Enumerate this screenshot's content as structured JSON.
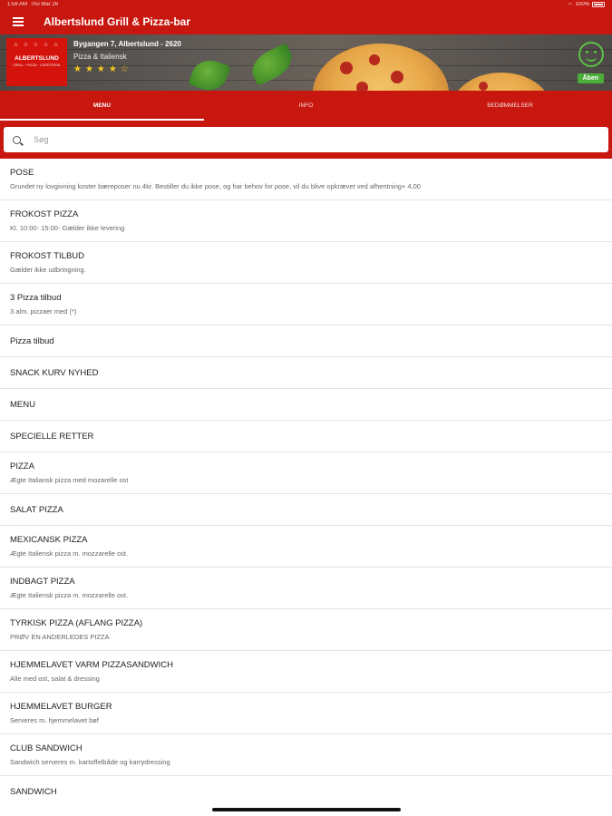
{
  "status_bar": {
    "time": "1:58 AM",
    "date": "Thu Mar 26",
    "wifi_icon": "wifi-icon",
    "battery": "100%"
  },
  "app_bar": {
    "menu_icon": "hamburger-icon",
    "title": "Albertslund Grill & Pizza-bar"
  },
  "banner": {
    "logo_stars": "☆ ☆ ☆ ☆ ☆",
    "logo_name": "ALBERTSLUND",
    "logo_sub": "GRILL · PIZZA · CAFETERIA",
    "address": "Bygangen 7, Albertslund - 2620",
    "category": "Pizza & Italiensk",
    "rating_stars": "★★★★☆",
    "rating_value": 4,
    "status_label": "Åben",
    "status_color": "#4caf3a"
  },
  "tabs": [
    {
      "label": "MENU",
      "active": true
    },
    {
      "label": "INFO",
      "active": false
    },
    {
      "label": "BEDØMMELSER",
      "active": false
    }
  ],
  "search": {
    "placeholder": "Søg",
    "value": ""
  },
  "menu_items": [
    {
      "title": "POSE",
      "desc": "Grundet ny lovgivning koster bæreposer nu 4kr. Bestiller du ikke pose, og har behov for pose, vil du blive opkrævet ved afhentning+ 4,00"
    },
    {
      "title": "FROKOST PIZZA",
      "desc": "Kl. 10:00- 15:00- Gælder ikke levering"
    },
    {
      "title": "FROKOST TILBUD",
      "desc": "Gælder ikke udbringning."
    },
    {
      "title": "3 Pizza tilbud",
      "desc": "3 alm. pizzaer med (*)"
    },
    {
      "title": "Pizza tilbud",
      "desc": ""
    },
    {
      "title": "SNACK KURV NYHED",
      "desc": ""
    },
    {
      "title": "MENU",
      "desc": ""
    },
    {
      "title": "SPECIELLE RETTER",
      "desc": ""
    },
    {
      "title": "PIZZA",
      "desc": "Ægte Italiansk pizza med mozarelle ost"
    },
    {
      "title": "SALAT PIZZA",
      "desc": ""
    },
    {
      "title": "MEXICANSK PIZZA",
      "desc": "Ægte Italiensk pizza m. mozzarelle ost."
    },
    {
      "title": "INDBAGT PIZZA",
      "desc": "Ægte Italiensk pizza m. mozzarelle ost."
    },
    {
      "title": "TYRKISK PIZZA (AFLANG PIZZA)",
      "desc": "PRØV EN ANDERLEDES PIZZA"
    },
    {
      "title": "HJEMMELAVET VARM PIZZASANDWICH",
      "desc": "Alle med ost, salat & dressing"
    },
    {
      "title": "HJEMMELAVET BURGER",
      "desc": "Serveres m. hjemmelavet bøf"
    },
    {
      "title": "CLUB SANDWICH",
      "desc": "Sandwich serveres m. kartoffelbåde og karrydressing"
    },
    {
      "title": "SANDWICH",
      "desc": ""
    }
  ]
}
